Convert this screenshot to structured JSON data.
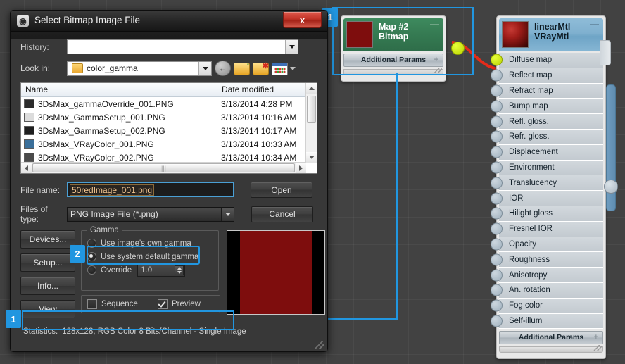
{
  "dialog": {
    "title": "Select Bitmap Image File",
    "app_icon": "max-logo-icon",
    "close_label": "x",
    "history": {
      "label": "History:",
      "value": "",
      "placeholder": ""
    },
    "lookin": {
      "label": "Look in:",
      "value": "color_gamma"
    },
    "toolbar": [
      {
        "name": "back-icon",
        "label": "←"
      },
      {
        "name": "up-folder-icon",
        "label": ""
      },
      {
        "name": "new-folder-icon",
        "label": ""
      },
      {
        "name": "views-icon",
        "label": ""
      }
    ],
    "filelist": {
      "columns": [
        "Name",
        "Date modified"
      ],
      "rows": [
        {
          "name": "3DsMax_gammaOverride_001.PNG",
          "date": "3/18/2014 4:28 PM"
        },
        {
          "name": "3DsMax_GammaSetup_001.PNG",
          "date": "3/13/2014 10:16 AM"
        },
        {
          "name": "3DsMax_GammaSetup_002.PNG",
          "date": "3/13/2014 10:17 AM"
        },
        {
          "name": "3DsMax_VRayColor_001.PNG",
          "date": "3/13/2014 10:33 AM"
        },
        {
          "name": "3DsMax_VRayColor_002.PNG",
          "date": "3/13/2014 10:34 AM"
        }
      ]
    },
    "filename": {
      "label": "File name:",
      "value": "50redImage_001.png"
    },
    "filetype": {
      "label": "Files of type:",
      "value": "PNG Image File (*.png)"
    },
    "open_label": "Open",
    "cancel_label": "Cancel",
    "side_buttons": [
      "Devices...",
      "Setup...",
      "Info...",
      "View"
    ],
    "gamma": {
      "legend": "Gamma",
      "options": [
        {
          "label": "Use image's own gamma",
          "selected": false
        },
        {
          "label": "Use system default gamma",
          "selected": true
        },
        {
          "label": "Override",
          "selected": false
        }
      ],
      "override_value": "1.0"
    },
    "sequence": {
      "label": "Sequence",
      "checked": false
    },
    "preview": {
      "label": "Preview",
      "checked": true
    },
    "statistics": {
      "label": "Statistics:",
      "value": "128x128, RGB Color 8 Bits/Channel - Single Image"
    }
  },
  "nodes": {
    "map": {
      "title": "Map #2",
      "subtitle": "Bitmap",
      "minimize": "—",
      "additional_params": "Additional Params",
      "plus": "+",
      "thumb_color": "#7e0d0d"
    },
    "material": {
      "title": "linearMtl",
      "subtitle": "VRayMtl",
      "minimize": "—",
      "additional_params": "Additional Params",
      "plus": "+",
      "slots": [
        {
          "label": "Diffuse map",
          "connected": true
        },
        {
          "label": "Reflect map",
          "connected": false
        },
        {
          "label": "Refract map",
          "connected": false
        },
        {
          "label": "Bump map",
          "connected": false
        },
        {
          "label": "Refl. gloss.",
          "connected": false
        },
        {
          "label": "Refr. gloss.",
          "connected": false
        },
        {
          "label": "Displacement",
          "connected": false
        },
        {
          "label": "Environment",
          "connected": false
        },
        {
          "label": "Translucency",
          "connected": false
        },
        {
          "label": "IOR",
          "connected": false
        },
        {
          "label": "Hilight gloss",
          "connected": false
        },
        {
          "label": "Fresnel IOR",
          "connected": false
        },
        {
          "label": "Opacity",
          "connected": false
        },
        {
          "label": "Roughness",
          "connected": false
        },
        {
          "label": "Anisotropy",
          "connected": false
        },
        {
          "label": "An. rotation",
          "connected": false
        },
        {
          "label": "Fog color",
          "connected": false
        },
        {
          "label": "Self-illum",
          "connected": false
        }
      ]
    }
  },
  "annotations": {
    "badge_1a": "1",
    "badge_1b": "1",
    "badge_2": "2"
  },
  "colors": {
    "accent": "#2196e0",
    "wire": "#e52b1a",
    "socket_active": "#d4ec15",
    "map_node_header": "#357a52",
    "mtl_node_header": "#7fb0cf",
    "swatch_red": "#7e0d0d",
    "close_button": "#c13327"
  }
}
